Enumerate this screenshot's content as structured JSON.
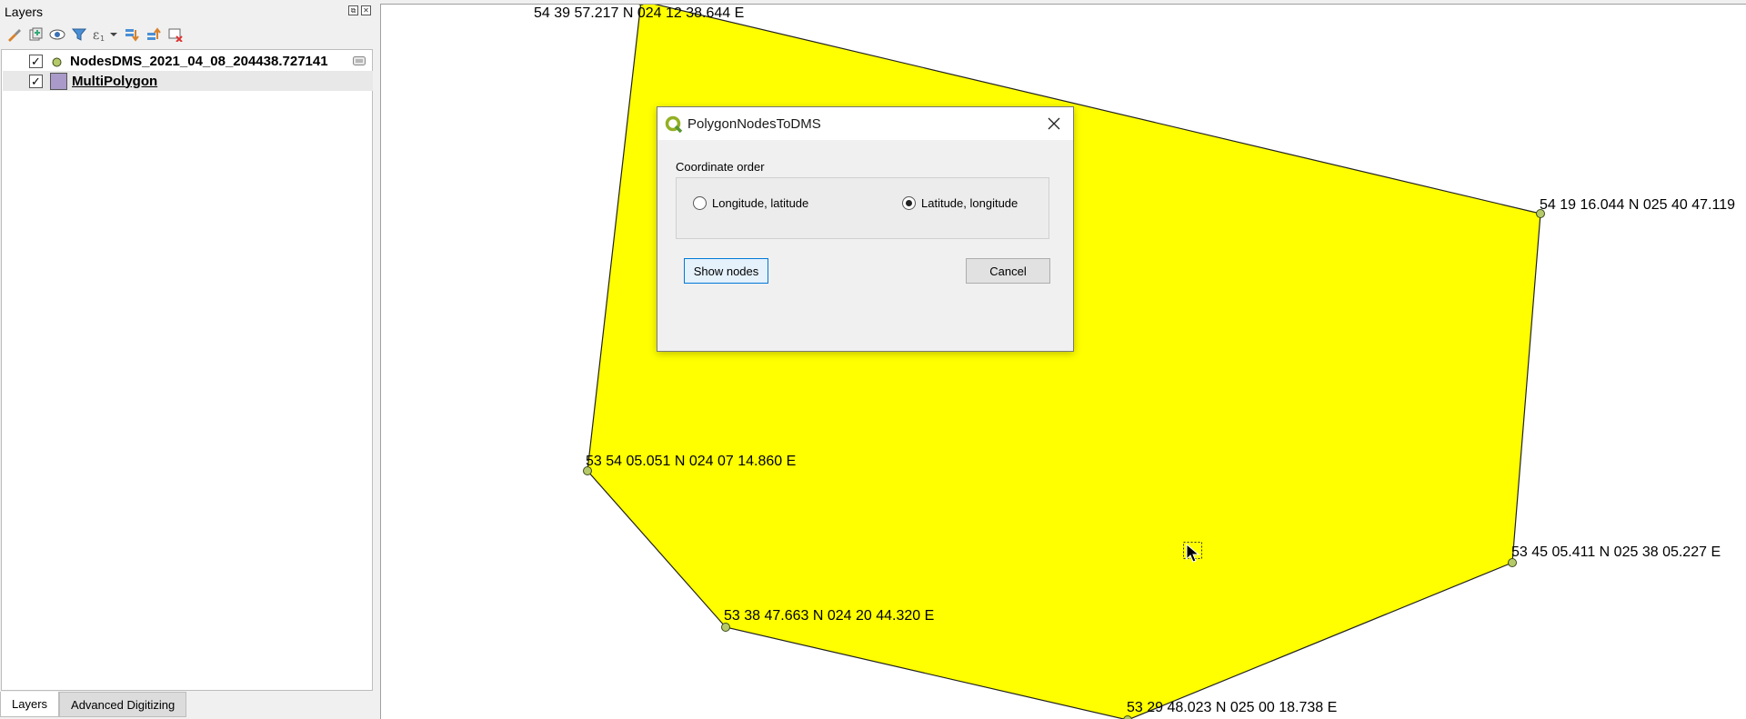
{
  "layers_panel": {
    "title": "Layers",
    "layers": [
      {
        "name": "NodesDMS_2021_04_08_204438.727141",
        "checked": "✓",
        "symbol": "point-symbol-icon"
      },
      {
        "name": "MultiPolygon",
        "checked": "✓",
        "symbol": "polygon-symbol-icon"
      }
    ],
    "bottom_tabs": [
      "Layers",
      "Advanced Digitizing"
    ]
  },
  "map": {
    "polygon_fill": "#ffff00",
    "node_color": "#b5c96a",
    "nodes": [
      {
        "label": "54 39 57.217 N 024 12 38.644 E"
      },
      {
        "label": "54 19 16.044 N 025 40 47.119"
      },
      {
        "label": "53 54 05.051 N 024 07 14.860 E"
      },
      {
        "label": "53 45 05.411 N 025 38 05.227 E"
      },
      {
        "label": "53 38 47.663 N 024 20 44.320 E"
      },
      {
        "label": "53 29 48.023 N 025 00 18.738 E"
      }
    ]
  },
  "dialog": {
    "title": "PolygonNodesToDMS",
    "group_label": "Coordinate order",
    "option_lonlat": "Longitude, latitude",
    "option_latlon": "Latitude, longitude",
    "selected": "Latitude, longitude",
    "show_nodes_label": "Show nodes",
    "cancel_label": "Cancel"
  }
}
